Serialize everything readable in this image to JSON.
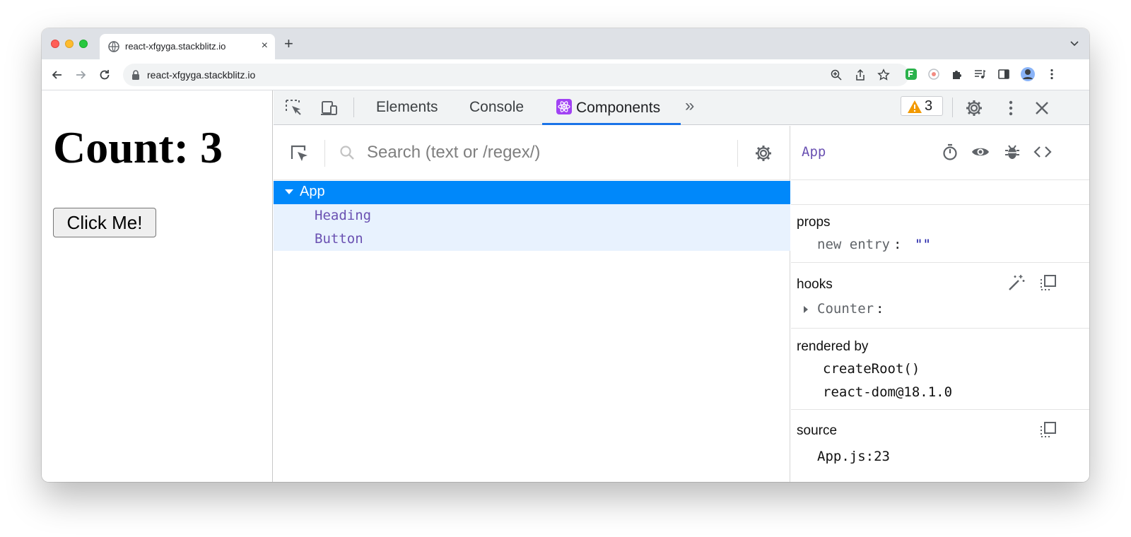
{
  "browser": {
    "tab_title": "react-xfgyga.stackblitz.io",
    "tab_close": "×",
    "new_tab": "+",
    "url": "react-xfgyga.stackblitz.io"
  },
  "page": {
    "heading": "Count: 3",
    "button_label": "Click Me!"
  },
  "devtools": {
    "tabs": [
      "Elements",
      "Console",
      "Components"
    ],
    "more_tabs": "»",
    "warning_count": "3",
    "search_placeholder": "Search (text or /regex/)",
    "tree": {
      "root": "App",
      "children": [
        "Heading",
        "Button"
      ]
    },
    "inspector": {
      "component": "App",
      "props_title": "props",
      "props": [
        {
          "key": "new entry",
          "value": "\"\""
        }
      ],
      "hooks_title": "hooks",
      "hooks": [
        {
          "name": "Counter"
        }
      ],
      "rendered_by_title": "rendered by",
      "rendered_by": [
        "createRoot()",
        "react-dom@18.1.0"
      ],
      "source_title": "source",
      "source": "App.js:23"
    }
  },
  "colors": {
    "selection": "#0088fa",
    "child_highlight": "#e8f2fe",
    "component_name": "#6a51b2",
    "tab_underline": "#1a73e8",
    "warning": "#f29900"
  }
}
